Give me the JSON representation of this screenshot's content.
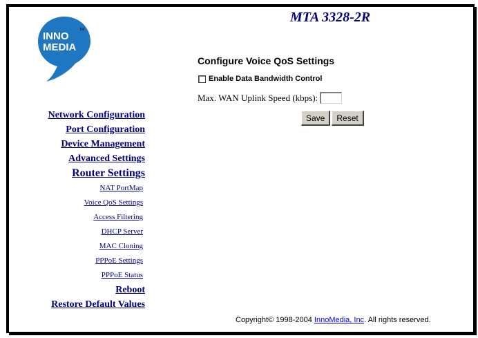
{
  "header": {
    "model": "MTA 3328-2R"
  },
  "logo": {
    "text_line1": "INNO",
    "text_line2": "MEDIA",
    "tm": "TM",
    "color": "#1f77c2"
  },
  "nav": {
    "network_configuration": "Network Configuration",
    "port_configuration": "Port Configuration",
    "device_management": "Device Management",
    "advanced_settings": "Advanced Settings",
    "router_settings": "Router Settings",
    "nat_portmap": "NAT PortMap",
    "voice_qos_settings": "Voice QoS Settings",
    "access_filtering": "Access Filtering",
    "dhcp_server": "DHCP Server",
    "mac_cloning": "MAC Cloning",
    "pppoe_settings": "PPPoE Settings",
    "pppoe_status": "PPPoE Status",
    "reboot": "Reboot",
    "restore_default_values": "Restore Default Values"
  },
  "form": {
    "title": "Configure Voice QoS Settings",
    "enable_bandwidth_label": "Enable Data Bandwidth Control",
    "enable_bandwidth_checked": false,
    "wan_speed_label": "Max. WAN Uplink Speed (kbps):",
    "wan_speed_value": "",
    "save_label": "Save",
    "reset_label": "Reset"
  },
  "footer": {
    "prefix": "Copyright© 1998-2004 ",
    "link": "InnoMedia, Inc",
    "suffix": ". All rights reserved."
  },
  "colors": {
    "nav_link": "#000080",
    "footer_link": "#0000ee",
    "button_face": "#d4d0c8"
  }
}
